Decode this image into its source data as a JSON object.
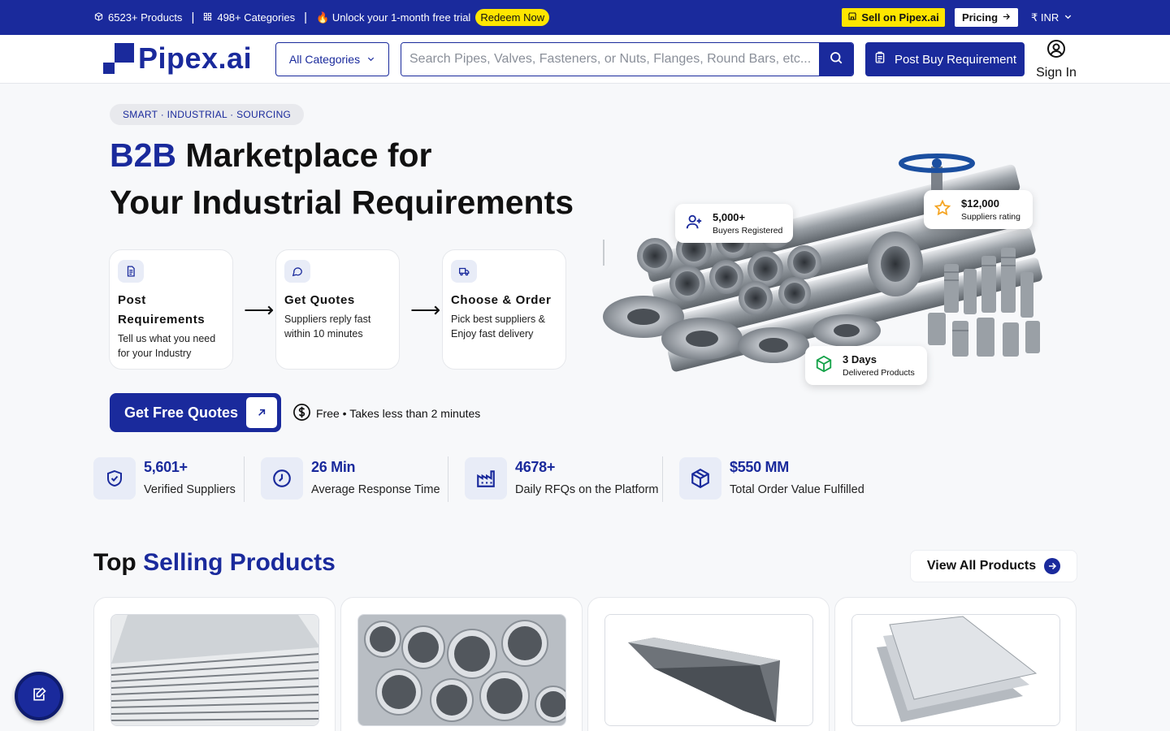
{
  "topbar": {
    "products_count": "6523+ Products",
    "categories_count": "498+ Categories",
    "trial_text": "🔥 Unlock your 1-month free trial",
    "redeem_label": "Redeem Now",
    "sell_label": "Sell on Pipex.ai",
    "pricing_label": "Pricing",
    "currency": "₹ INR",
    "separator": "|"
  },
  "header": {
    "logo_text": "Pipex.ai",
    "categories_label": "All Categories",
    "search_placeholder": "Search Pipes, Valves, Fasteners, or Nuts, Flanges, Round Bars, etc...",
    "post_label": "Post Buy Requirement",
    "signin_label": "Sign In"
  },
  "hero": {
    "tagline": "SMART · INDUSTRIAL · SOURCING",
    "title_accent": "B2B",
    "title_rest": " Marketplace for",
    "title_line2": "Your Industrial Requirements",
    "steps": [
      {
        "title": "Post Requirements",
        "desc": "Tell us what you need for your Industry",
        "icon": "document-icon"
      },
      {
        "title": "Get Quotes",
        "desc": "Suppliers reply fast within 10 minutes",
        "icon": "chat-bubble-icon"
      },
      {
        "title": "Choose & Order",
        "desc": "Pick best suppliers & Enjoy fast delivery",
        "icon": "truck-icon"
      }
    ],
    "arrow": "⟶",
    "cta_label": "Get Free Quotes",
    "free_note": "Free • Takes less than 2 minutes",
    "badges": [
      {
        "value": "5,000+",
        "label": "Buyers Registered",
        "icon": "user-plus-icon"
      },
      {
        "value": "$12,000",
        "label": "Suppliers rating",
        "icon": "star-icon"
      },
      {
        "value": "3 Days",
        "label": "Delivered Products",
        "icon": "box-icon"
      }
    ]
  },
  "stats": [
    {
      "value": "5,601+",
      "label": "Verified Suppliers",
      "icon": "shield-check-icon"
    },
    {
      "value": "26 Min",
      "label": "Average Response Time",
      "icon": "clock-icon"
    },
    {
      "value": "4678+",
      "label": "Daily RFQs on the Platform",
      "icon": "factory-icon"
    },
    {
      "value": "$550 MM",
      "label": "Total Order Value Fulfilled",
      "icon": "package-icon"
    }
  ],
  "products_section": {
    "title_plain": "Top ",
    "title_accent": "Selling Products",
    "view_all_label": "View All Products",
    "products": [
      {
        "image": "stacked-steel-plates"
      },
      {
        "image": "steel-pipes-bundle"
      },
      {
        "image": "metal-gutter-channel"
      },
      {
        "image": "aluminium-sheets"
      }
    ]
  },
  "colors": {
    "brand": "#1a2a9c",
    "highlight": "#ffe600",
    "background": "#f7f8fa"
  }
}
